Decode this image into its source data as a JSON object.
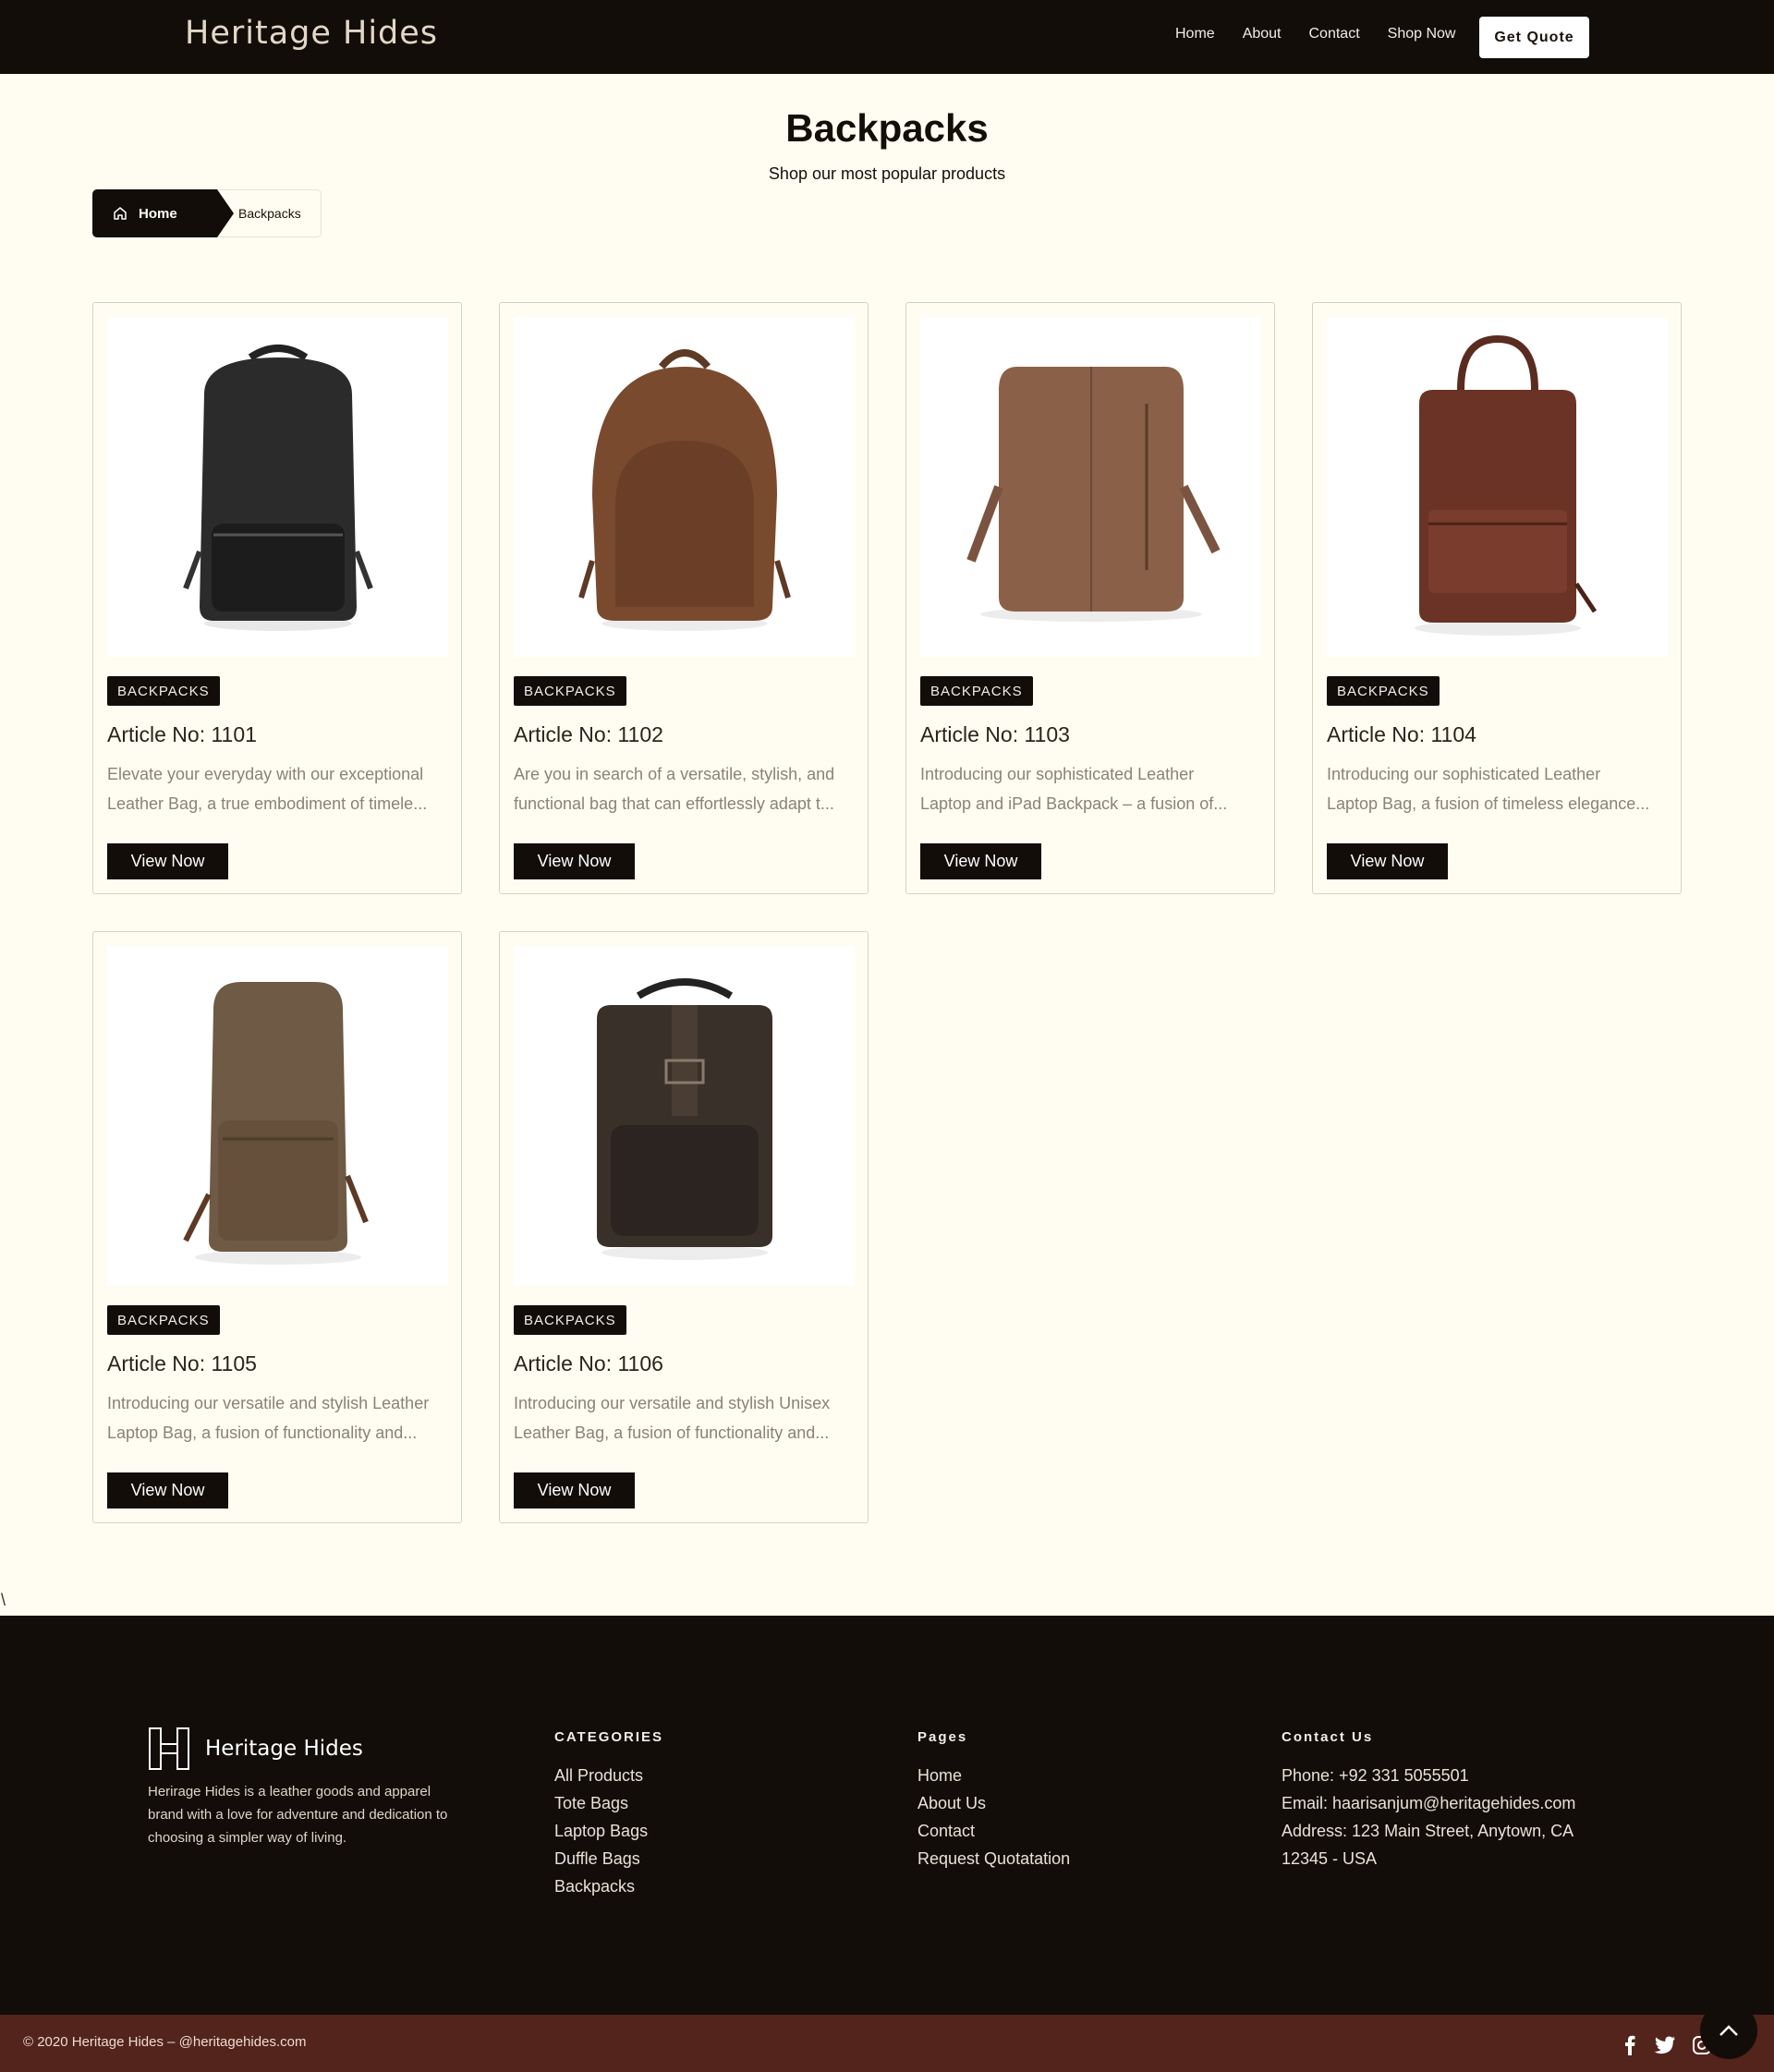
{
  "header": {
    "brand": "Heritage Hides",
    "nav": [
      "Home",
      "About",
      "Contact",
      "Shop Now"
    ],
    "quote_label": "Get Quote"
  },
  "page": {
    "title": "Backpacks",
    "subtitle": "Shop our most popular products"
  },
  "breadcrumb": {
    "home": "Home",
    "current": "Backpacks"
  },
  "products": [
    {
      "category": "BACKPACKS",
      "title": "Article No: 1101",
      "desc1": "Elevate your everyday with our exceptional",
      "desc2": "Leather Bag, a true embodiment of timele...",
      "button": "View Now",
      "color": "#2a2a2a"
    },
    {
      "category": "BACKPACKS",
      "title": "Article No: 1102",
      "desc1": "Are you in search of a versatile, stylish, and",
      "desc2": "functional bag that can effortlessly adapt t...",
      "button": "View Now",
      "color": "#7a4a2e"
    },
    {
      "category": "BACKPACKS",
      "title": "Article No: 1103",
      "desc1": "Introducing our sophisticated Leather",
      "desc2": "Laptop and iPad Backpack – a fusion of...",
      "button": "View Now",
      "color": "#8a6148"
    },
    {
      "category": "BACKPACKS",
      "title": "Article No: 1104",
      "desc1": "Introducing our sophisticated Leather",
      "desc2": "Laptop Bag, a fusion of timeless elegance...",
      "button": "View Now",
      "color": "#6a3326"
    },
    {
      "category": "BACKPACKS",
      "title": "Article No: 1105",
      "desc1": "Introducing our versatile and stylish Leather",
      "desc2": "Laptop Bag, a fusion of functionality and...",
      "button": "View Now",
      "color": "#6e5a45"
    },
    {
      "category": "BACKPACKS",
      "title": "Article No: 1106",
      "desc1": "Introducing our versatile and stylish Unisex",
      "desc2": "Leather Bag, a fusion of functionality and...",
      "button": "View Now",
      "color": "#3a302a"
    }
  ],
  "stray_char": "\\",
  "footer": {
    "brand": "Heritage Hides",
    "about": "Herirage Hides is a leather goods and apparel brand with a love for adventure and dedication to choosing a simpler way of living.",
    "categories_title": "CATEGORIES",
    "categories": [
      "All Products",
      "Tote Bags",
      "Laptop Bags",
      "Duffle Bags",
      "Backpacks"
    ],
    "pages_title": "Pages",
    "pages": [
      "Home",
      "About Us",
      "Contact",
      "Request Quotatation"
    ],
    "contact_title": "Contact Us",
    "contact": [
      "Phone: +92 331 5055501",
      "Email: haarisanjum@heritagehides.com",
      "Address: 123 Main Street, Anytown, CA",
      "12345 - USA"
    ],
    "copyright": "© 2020 Heritage Hides – @heritagehides.com",
    "socials": [
      "facebook-icon",
      "twitter-icon",
      "instagram-icon"
    ]
  }
}
